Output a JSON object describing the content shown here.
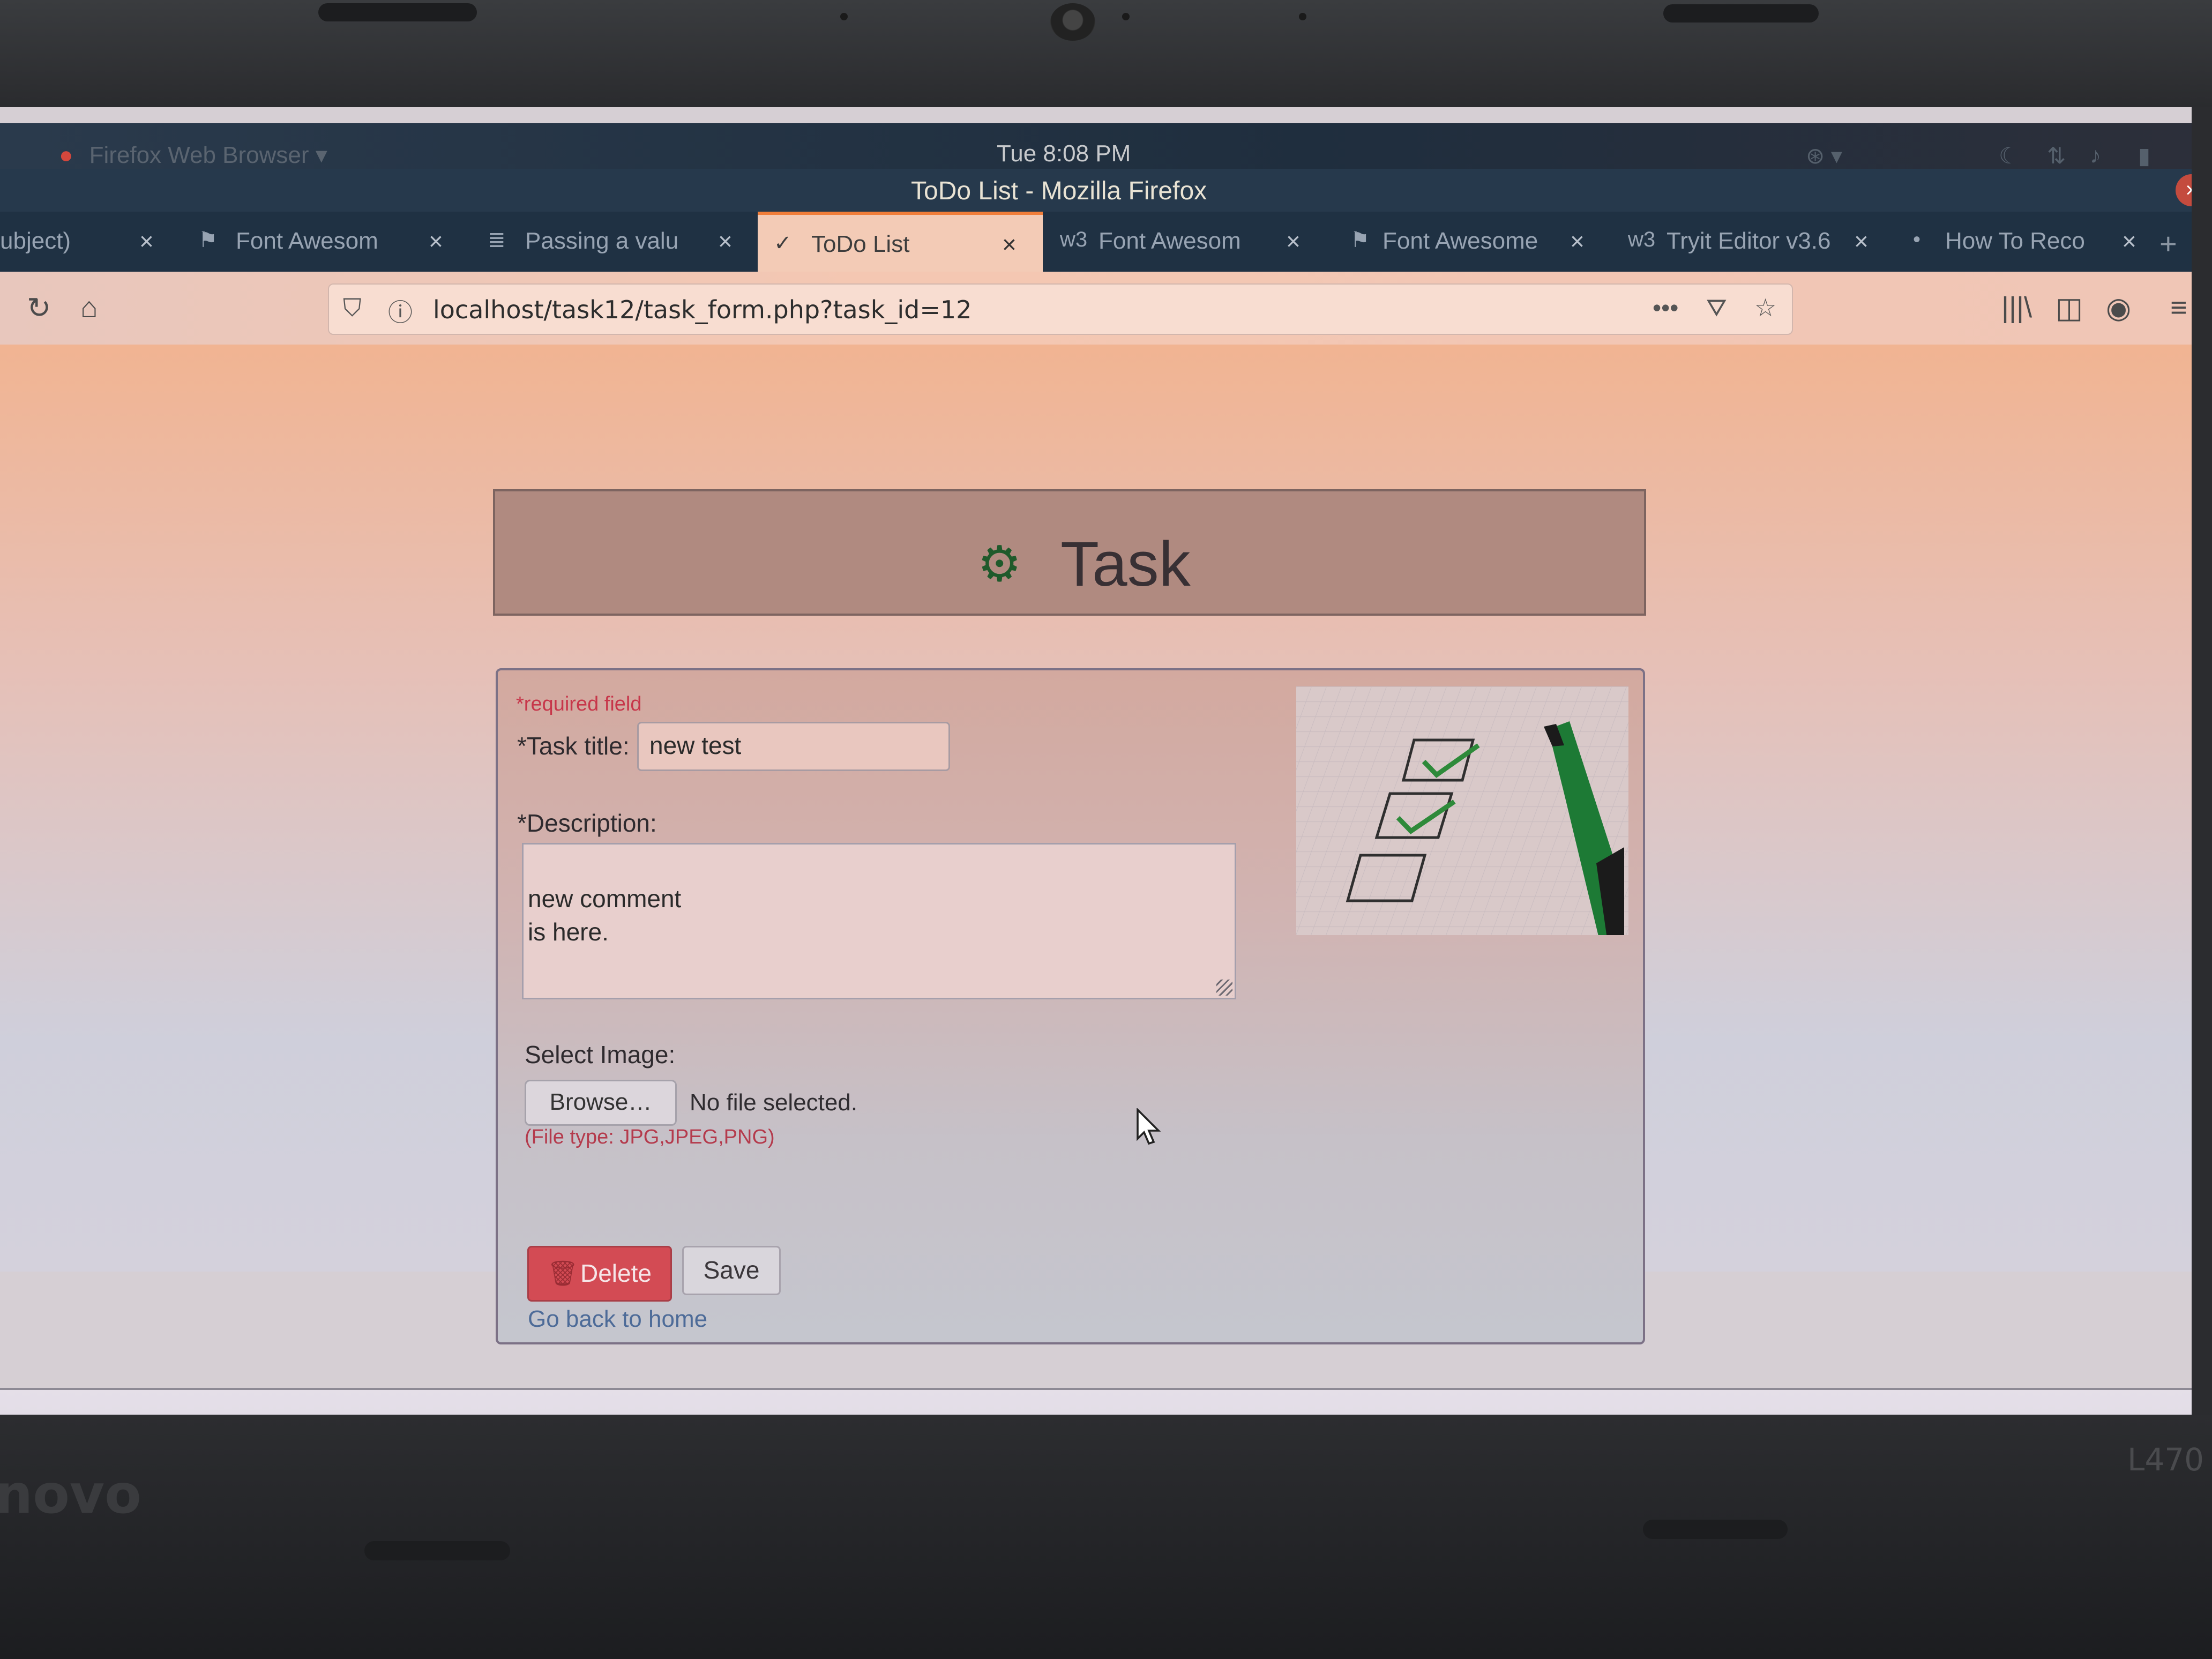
{
  "os_bar": {
    "app_menu": "Firefox Web Browser ▾",
    "clock": "Tue  8:08 PM"
  },
  "window": {
    "title": "ToDo List - Mozilla Firefox"
  },
  "tabs": [
    {
      "label": "ubject)",
      "icon": ""
    },
    {
      "label": "Font Awesom",
      "icon": "flag-icon"
    },
    {
      "label": "Passing a valu",
      "icon": "stack-icon"
    },
    {
      "label": "ToDo List",
      "icon": "check-circle-icon",
      "active": true
    },
    {
      "label": "Font Awesom",
      "icon": "w3-icon"
    },
    {
      "label": "Font Awesome",
      "icon": "flag-icon"
    },
    {
      "label": "Tryit Editor v3.6",
      "icon": "w3-icon"
    },
    {
      "label": "How To Reco",
      "icon": "dot-icon"
    }
  ],
  "address_bar": {
    "url": "localhost/task12/task_form.php?task_id=12"
  },
  "page": {
    "header_title": "Task",
    "required_note": "*required field",
    "task_title_label": "*Task title:",
    "task_title_value": "new test",
    "description_label": "*Description:",
    "description_value": "new comment\nis here.",
    "select_image_label": "Select Image:",
    "browse_label": "Browse…",
    "no_file_text": "No file selected.",
    "file_type_note": "(File type: JPG,JPEG,PNG)",
    "delete_label": "Delete",
    "save_label": "Save",
    "back_link": "Go back to home"
  },
  "laptop": {
    "brand": "novo",
    "model": "L470"
  },
  "colors": {
    "accent_tab": "#f17e3a",
    "delete_button": "#d34b54",
    "gear_icon": "#1f5a2b",
    "required_text": "#c7364a",
    "link": "#4d6b98"
  }
}
